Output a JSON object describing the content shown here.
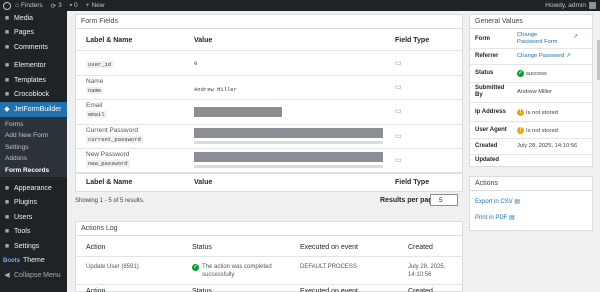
{
  "adminbar": {
    "site_name": "Finders",
    "updates": "3",
    "comments": "0",
    "new_label": "New",
    "howdy": "Howdy, admin"
  },
  "sidebar": {
    "items_top": [
      {
        "label": "Media",
        "icon": "media-icon"
      },
      {
        "label": "Pages",
        "icon": "pages-icon"
      },
      {
        "label": "Comments",
        "icon": "comments-icon"
      }
    ],
    "items_mid": [
      {
        "label": "Elementor",
        "icon": "elementor-icon"
      },
      {
        "label": "Templates",
        "icon": "templates-icon"
      },
      {
        "label": "Crocoblock",
        "icon": "crocoblock-icon"
      }
    ],
    "active": {
      "label": "JetFormBuilder",
      "icon": "jetformbuilder-icon"
    },
    "submenu": [
      "Forms",
      "Add New Form",
      "Settings",
      "Addons",
      "Form Records"
    ],
    "submenu_current": 4,
    "items_bottom": [
      {
        "label": "Appearance",
        "icon": "appearance-icon"
      },
      {
        "label": "Plugins",
        "icon": "plugins-icon"
      },
      {
        "label": "Users",
        "icon": "users-icon"
      },
      {
        "label": "Tools",
        "icon": "tools-icon"
      },
      {
        "label": "Settings",
        "icon": "settings-icon"
      }
    ],
    "theme_prefix": "Boots",
    "theme_label": "Theme",
    "collapse": "Collapse Menu"
  },
  "form_fields": {
    "title": "Form Fields",
    "col_label": "Label & Name",
    "col_value": "Value",
    "col_type": "Field Type",
    "rows": [
      {
        "label": "",
        "name": "user_id",
        "value": "0"
      },
      {
        "label": "Name",
        "name": "name",
        "value": "Andrew Miller"
      },
      {
        "label": "Email",
        "name": "email",
        "value": ""
      },
      {
        "label": "Current Password",
        "name": "current_password",
        "value": ""
      },
      {
        "label": "New Password",
        "name": "new_password",
        "value": ""
      }
    ]
  },
  "footer": {
    "showing": "Showing 1 - 5 of 5 results.",
    "rpp_label": "Results per page",
    "rpp_value": "5"
  },
  "actions_log": {
    "title": "Actions Log",
    "col_action": "Action",
    "col_status": "Status",
    "col_event": "Executed on event",
    "col_created": "Created",
    "row": {
      "action": "Update User (8591)",
      "status": "The action was completed successfully",
      "event": "DEFAULT.PROCESS",
      "created": "July 28, 2025, 14:10:56"
    }
  },
  "general_values": {
    "title": "General Values",
    "rows": [
      {
        "label": "Form",
        "value": "Change Password Form",
        "type": "link"
      },
      {
        "label": "Referrer",
        "value": "Change Password",
        "type": "link"
      },
      {
        "label": "Status",
        "value": "success",
        "type": "ok"
      },
      {
        "label": "Submitted By",
        "value": "Andrew Miller",
        "type": "text"
      },
      {
        "label": "Ip Address",
        "value": "Is not stored",
        "type": "warn"
      },
      {
        "label": "User Agent",
        "value": "Is not stored",
        "type": "warn"
      },
      {
        "label": "Created",
        "value": "July 28, 2025, 14:10:56",
        "type": "text"
      },
      {
        "label": "Updated",
        "value": "",
        "type": "text"
      }
    ]
  },
  "actions_box": {
    "title": "Actions",
    "export_csv": "Export in CSV",
    "print_pdf": "Print in PDF"
  }
}
